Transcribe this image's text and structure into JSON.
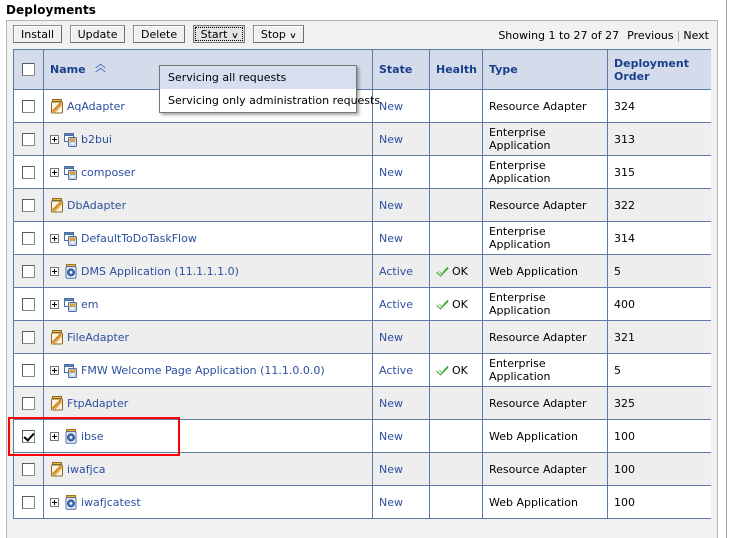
{
  "page": {
    "title": "Deployments"
  },
  "toolbar": {
    "buttons": [
      {
        "label": "Install",
        "has_caret": false,
        "pressed": false
      },
      {
        "label": "Update",
        "has_caret": false,
        "pressed": false
      },
      {
        "label": "Delete",
        "has_caret": false,
        "pressed": false
      },
      {
        "label": "Start",
        "has_caret": true,
        "pressed": true
      },
      {
        "label": "Stop",
        "has_caret": true,
        "pressed": false
      }
    ],
    "caret_glyph": "∨"
  },
  "start_menu": {
    "open": true,
    "items": [
      {
        "label": "Servicing all requests",
        "highlighted": true
      },
      {
        "label": "Servicing only administration requests",
        "highlighted": false
      }
    ]
  },
  "pager": {
    "showing": "Showing 1 to 27 of 27",
    "previous": "Previous",
    "separator": "|",
    "next": "Next"
  },
  "table": {
    "columns": [
      {
        "key": "check",
        "label": ""
      },
      {
        "key": "name",
        "label": "Name",
        "sorted": true,
        "sort_icon": "sort-ascending-icon"
      },
      {
        "key": "state",
        "label": "State"
      },
      {
        "key": "health",
        "label": "Health"
      },
      {
        "key": "type",
        "label": "Type"
      },
      {
        "key": "order",
        "label": "Deployment Order"
      }
    ],
    "header_checkbox": {
      "checked": false
    },
    "rows": [
      {
        "checked": false,
        "expandable": false,
        "icon": "resource-adapter-icon",
        "name": "AqAdapter",
        "state": "New",
        "health": "",
        "type": "Resource Adapter",
        "order": "324"
      },
      {
        "checked": false,
        "expandable": true,
        "icon": "enterprise-application-icon",
        "name": "b2bui",
        "state": "New",
        "health": "",
        "type": "Enterprise Application",
        "order": "313"
      },
      {
        "checked": false,
        "expandable": true,
        "icon": "enterprise-application-icon",
        "name": "composer",
        "state": "New",
        "health": "",
        "type": "Enterprise Application",
        "order": "315"
      },
      {
        "checked": false,
        "expandable": false,
        "icon": "resource-adapter-icon",
        "name": "DbAdapter",
        "state": "New",
        "health": "",
        "type": "Resource Adapter",
        "order": "322"
      },
      {
        "checked": false,
        "expandable": true,
        "icon": "enterprise-application-icon",
        "name": "DefaultToDoTaskFlow",
        "state": "New",
        "health": "",
        "type": "Enterprise Application",
        "order": "314"
      },
      {
        "checked": false,
        "expandable": true,
        "icon": "web-application-icon",
        "name": "DMS Application (11.1.1.1.0)",
        "state": "Active",
        "health": "OK",
        "type": "Web Application",
        "order": "5"
      },
      {
        "checked": false,
        "expandable": true,
        "icon": "enterprise-application-icon",
        "name": "em",
        "state": "Active",
        "health": "OK",
        "type": "Enterprise Application",
        "order": "400"
      },
      {
        "checked": false,
        "expandable": false,
        "icon": "resource-adapter-icon",
        "name": "FileAdapter",
        "state": "New",
        "health": "",
        "type": "Resource Adapter",
        "order": "321"
      },
      {
        "checked": false,
        "expandable": true,
        "icon": "enterprise-application-icon",
        "name": "FMW Welcome Page Application (11.1.0.0.0)",
        "state": "Active",
        "health": "OK",
        "type": "Enterprise Application",
        "order": "5"
      },
      {
        "checked": false,
        "expandable": false,
        "icon": "resource-adapter-icon",
        "name": "FtpAdapter",
        "state": "New",
        "health": "",
        "type": "Resource Adapter",
        "order": "325"
      },
      {
        "checked": true,
        "expandable": true,
        "icon": "web-application-icon",
        "name": "ibse",
        "state": "New",
        "health": "",
        "type": "Web Application",
        "order": "100",
        "highlighted": true
      },
      {
        "checked": false,
        "expandable": false,
        "icon": "resource-adapter-icon",
        "name": "iwafjca",
        "state": "New",
        "health": "",
        "type": "Resource Adapter",
        "order": "100"
      },
      {
        "checked": false,
        "expandable": true,
        "icon": "web-application-icon",
        "name": "iwafjcatest",
        "state": "New",
        "health": "",
        "type": "Web Application",
        "order": "100"
      }
    ]
  },
  "colors": {
    "header_bg": "#d4dcec",
    "header_text": "#1b3f8b",
    "link": "#2b4f9e",
    "grid_border": "#5b7ca6",
    "alt_row": "#eeeeee",
    "panel_bg": "#f1f1f1",
    "menu_highlight": "#d6dff0",
    "annotation": "#ff0000",
    "health_ok": "#2e9a29"
  }
}
